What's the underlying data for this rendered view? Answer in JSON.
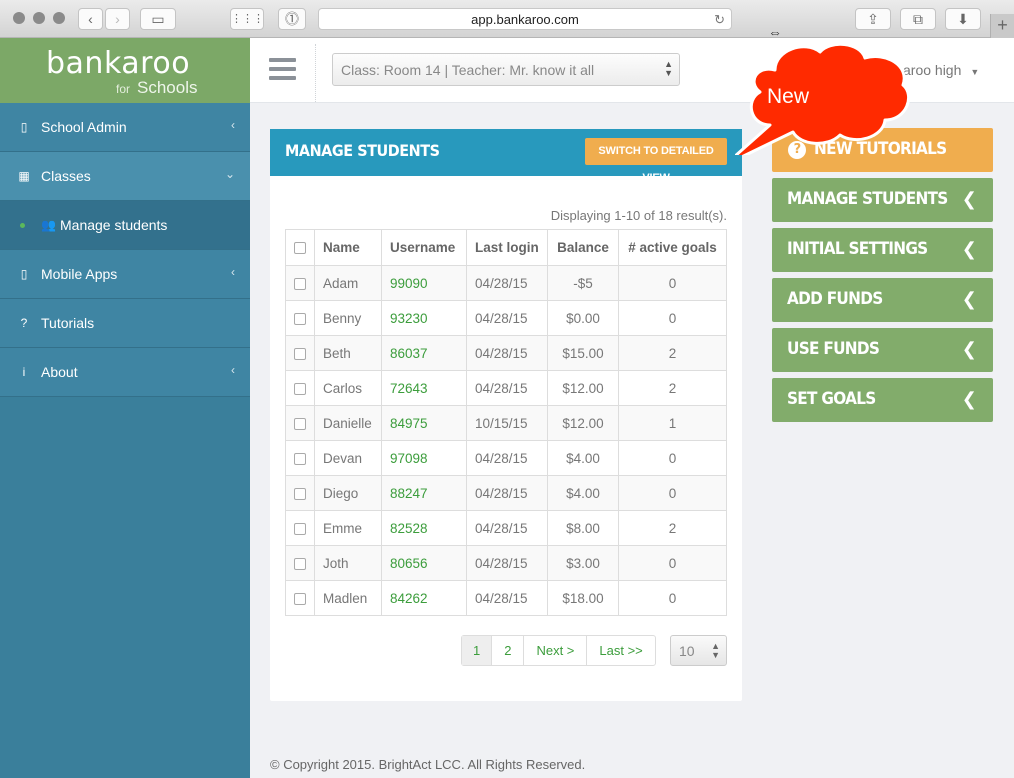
{
  "browser": {
    "url": "app.bankaroo.com"
  },
  "logo": {
    "main": "bankaroo",
    "for": "for",
    "schools": "Schools"
  },
  "sidebar": {
    "items": [
      {
        "label": "School Admin",
        "icon": "building-icon"
      },
      {
        "label": "Classes",
        "icon": "grid-icon"
      },
      {
        "label": "Manage students",
        "icon": "users-icon"
      },
      {
        "label": "Mobile Apps",
        "icon": "mobile-icon"
      },
      {
        "label": "Tutorials",
        "icon": "question-circle-icon"
      },
      {
        "label": "About",
        "icon": "info-circle-icon"
      }
    ]
  },
  "topbar": {
    "class_select": "Class: Room 14 | Teacher: Mr. know it all",
    "user": "aroo high"
  },
  "callout": {
    "text": "New"
  },
  "panel": {
    "title": "MANAGE STUDENTS",
    "switch_button": "SWITCH TO DETAILED VIEW",
    "display_info": "Displaying 1-10 of 18 result(s).",
    "columns": [
      "Name",
      "Username",
      "Last login",
      "Balance",
      "# active goals"
    ],
    "rows": [
      {
        "name": "Adam",
        "username": "99090",
        "last_login": "04/28/15",
        "balance": "-$5",
        "goals": "0"
      },
      {
        "name": "Benny",
        "username": "93230",
        "last_login": "04/28/15",
        "balance": "$0.00",
        "goals": "0"
      },
      {
        "name": "Beth",
        "username": "86037",
        "last_login": "04/28/15",
        "balance": "$15.00",
        "goals": "2"
      },
      {
        "name": "Carlos",
        "username": "72643",
        "last_login": "04/28/15",
        "balance": "$12.00",
        "goals": "2"
      },
      {
        "name": "Danielle",
        "username": "84975",
        "last_login": "10/15/15",
        "balance": "$12.00",
        "goals": "1"
      },
      {
        "name": "Devan",
        "username": "97098",
        "last_login": "04/28/15",
        "balance": "$4.00",
        "goals": "0"
      },
      {
        "name": "Diego",
        "username": "88247",
        "last_login": "04/28/15",
        "balance": "$4.00",
        "goals": "0"
      },
      {
        "name": "Emme",
        "username": "82528",
        "last_login": "04/28/15",
        "balance": "$8.00",
        "goals": "2"
      },
      {
        "name": "Joth",
        "username": "80656",
        "last_login": "04/28/15",
        "balance": "$3.00",
        "goals": "0"
      },
      {
        "name": "Madlen",
        "username": "84262",
        "last_login": "04/28/15",
        "balance": "$18.00",
        "goals": "0"
      }
    ],
    "pagination": {
      "pages": [
        "1",
        "2"
      ],
      "next": "Next >",
      "last": "Last >>",
      "page_size": "10"
    }
  },
  "actions": {
    "new_tutorials": "NEW TUTORIALS",
    "manage_students": "MANAGE STUDENTS",
    "initial_settings": "INITIAL SETTINGS",
    "add_funds": "ADD FUNDS",
    "use_funds": "USE FUNDS",
    "set_goals": "SET GOALS"
  },
  "footer": {
    "text": "© Copyright 2015. BrightAct LCC. All Rights Reserved."
  },
  "colors": {
    "sidebar": "#3a7f9b",
    "logo_bg": "#7ca867",
    "panel_header": "#2899bd",
    "orange": "#f0ad4e",
    "green_action": "#82ac6b",
    "callout": "#ff2a00"
  }
}
